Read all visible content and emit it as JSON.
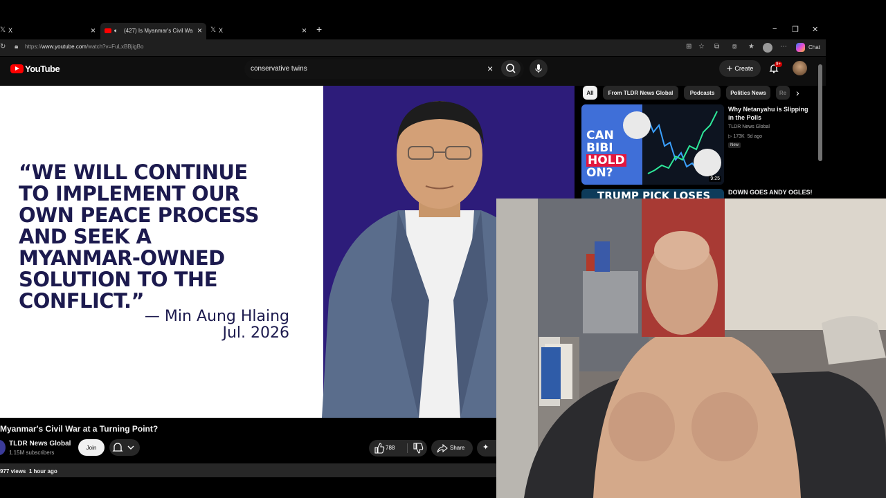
{
  "browser": {
    "tabs": [
      {
        "label": "X",
        "close": "×"
      },
      {
        "label": "(427) Is Myanmar's Civil War a",
        "close": "×"
      },
      {
        "label": "X",
        "close": "×"
      }
    ],
    "new_tab": "+",
    "window_controls": {
      "minimize": "−",
      "restore": "❐",
      "close": "✕"
    },
    "url_prefix": "https://",
    "url_domain": "www.youtube.com",
    "url_path": "/watch?v=FuLxBBjigBo",
    "chat_label": "Chat"
  },
  "youtube": {
    "logo_text": "YouTube",
    "search_query": "conservative twins",
    "search_clear": "×",
    "create_label": "Create",
    "notification_badge": "9+"
  },
  "video": {
    "quote_lines": [
      "“WE WILL CONTINUE",
      "TO IMPLEMENT OUR",
      "OWN PEACE PROCESS",
      "AND SEEK A",
      "MYANMAR-OWNED",
      "SOLUTION TO THE",
      "CONFLICT.”"
    ],
    "attribution": "— Min Aung Hlaing",
    "date": "Jul. 2026",
    "title": "Myanmar's Civil War at a Turning Point?",
    "channel": "TLDR News Global",
    "subscribers": "1.15M subscribers",
    "join_label": "Join",
    "likes": "788",
    "share_label": "Share",
    "views": "977 views",
    "posted": "1 hour ago"
  },
  "sidebar": {
    "chips": [
      "All",
      "From TLDR News Global",
      "Podcasts",
      "Politics News",
      "Re"
    ],
    "recommended": [
      {
        "title": "Why Netanyahu is Slipping in the Polls",
        "channel": "TLDR News Global",
        "views": "173K",
        "age": "5d ago",
        "badge": "New",
        "duration": "9:25",
        "thumb_text": [
          "CAN",
          "BIBI",
          "HOLD",
          "ON?"
        ]
      },
      {
        "title": "DOWN GOES ANDY OGLES!",
        "thumb_text": "TRUMP PICK LOSES"
      }
    ]
  },
  "colors": {
    "quote_navy": "#1c1a4e",
    "slide_purple": "#2d1c7a",
    "yt_red": "#ff0000",
    "bg_dark": "#0f0f0f"
  }
}
